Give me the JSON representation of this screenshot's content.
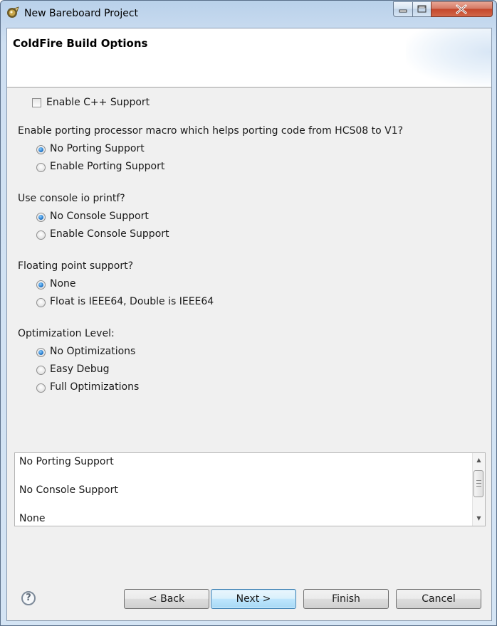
{
  "window": {
    "title": "New Bareboard Project",
    "controls": {
      "minimize": "minimize",
      "maximize": "maximize",
      "close": "close"
    }
  },
  "banner": {
    "title": "ColdFire Build Options"
  },
  "cpp_support": {
    "label": "Enable C++ Support",
    "checked": false
  },
  "porting": {
    "question": "Enable porting processor macro which helps porting code from HCS08 to V1?",
    "options": [
      {
        "label": "No Porting Support",
        "selected": true
      },
      {
        "label": "Enable Porting Support",
        "selected": false
      }
    ]
  },
  "console": {
    "question": "Use console io printf?",
    "options": [
      {
        "label": "No Console Support",
        "selected": true
      },
      {
        "label": "Enable Console Support",
        "selected": false
      }
    ]
  },
  "floating_point": {
    "question": "Floating point support?",
    "options": [
      {
        "label": "None",
        "selected": true
      },
      {
        "label": "Float is IEEE64, Double is IEEE64",
        "selected": false
      }
    ]
  },
  "optimization": {
    "question": "Optimization Level:",
    "options": [
      {
        "label": "No Optimizations",
        "selected": true
      },
      {
        "label": "Easy Debug",
        "selected": false
      },
      {
        "label": "Full Optimizations",
        "selected": false
      }
    ]
  },
  "summary": {
    "lines": [
      "No Porting Support",
      "No Console Support",
      "None"
    ]
  },
  "buttons": {
    "help": "?",
    "back": "< Back",
    "next": "Next >",
    "finish": "Finish",
    "cancel": "Cancel"
  },
  "colors": {
    "accent_radio": "#2b7fd0",
    "default_button_border": "#3c7fb1",
    "close_button": "#c4472c"
  },
  "icons": {
    "app": "eclipse-wizard-icon",
    "help": "help-icon",
    "scroll_up": "chevron-up-icon",
    "scroll_down": "chevron-down-icon"
  }
}
